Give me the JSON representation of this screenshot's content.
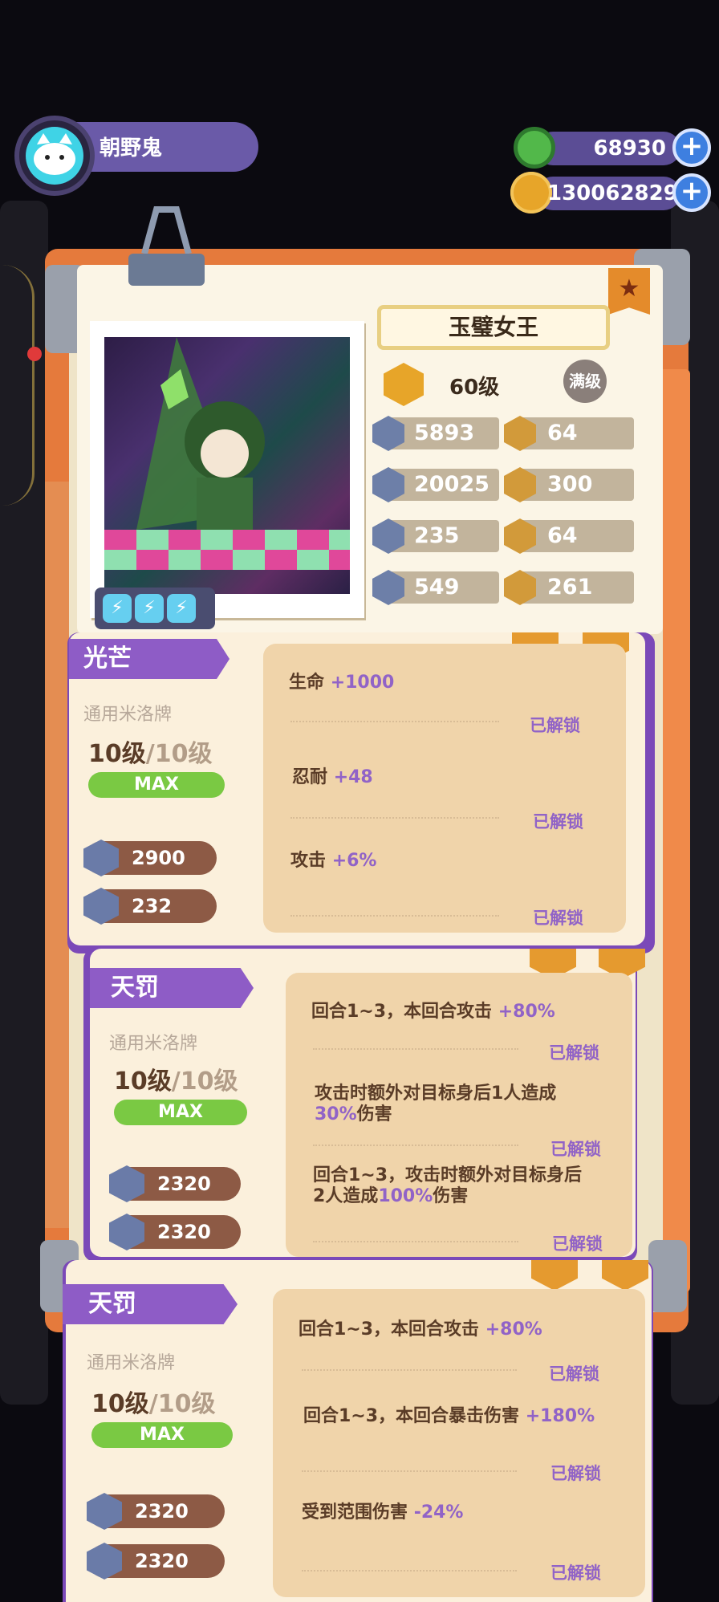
{
  "player": {
    "name": "朝野鬼"
  },
  "resources": [
    {
      "name": "green-currency",
      "value": "68930"
    },
    {
      "name": "gold-currency",
      "value": "130062829"
    }
  ],
  "character": {
    "name": "玉璧女王",
    "level": "60级",
    "max_badge": "满级",
    "energy": [
      "⚡",
      "⚡",
      "⚡"
    ],
    "stats": [
      {
        "icon": "heart-shield-icon",
        "value": "5893",
        "side": "left"
      },
      {
        "icon": "muscle-icon",
        "value": "64",
        "side": "right"
      },
      {
        "icon": "sword-icon",
        "value": "20025",
        "side": "left"
      },
      {
        "icon": "face-icon",
        "value": "300",
        "side": "right"
      },
      {
        "icon": "shield-icon",
        "value": "235",
        "side": "left"
      },
      {
        "icon": "arm-icon",
        "value": "64",
        "side": "right"
      },
      {
        "icon": "anchor-icon",
        "value": "549",
        "side": "left"
      },
      {
        "icon": "brain-icon",
        "value": "261",
        "side": "right"
      }
    ]
  },
  "modules": [
    {
      "title": "光芒",
      "subtitle": "通用米洛牌",
      "level": "10级",
      "level_max": "/10级",
      "max_label": "MAX",
      "stats": [
        {
          "icon": "heart-shield-icon",
          "value": "2900"
        },
        {
          "icon": "anchor-icon",
          "value": "232"
        }
      ],
      "effects": [
        {
          "text": "生命",
          "bonus": "+1000",
          "status": "已解锁"
        },
        {
          "text": "忍耐",
          "bonus": "+48",
          "status": "已解锁"
        },
        {
          "text": "攻击",
          "bonus": "+6%",
          "status": "已解锁"
        }
      ]
    },
    {
      "title": "天罚",
      "subtitle": "通用米洛牌",
      "level": "10级",
      "level_max": "/10级",
      "max_label": "MAX",
      "stats": [
        {
          "icon": "sword-icon",
          "value": "2320"
        },
        {
          "icon": "sword-icon",
          "value": "2320"
        }
      ],
      "effects": [
        {
          "text": "回合1~3，本回合攻击",
          "bonus": "+80%",
          "status": "已解锁"
        },
        {
          "text_a": "攻击时额外对目标身后1人造成",
          "bonus": "30%",
          "text_b": "伤害",
          "status": "已解锁"
        },
        {
          "text_a": "回合1~3，攻击时额外对目标身后2人造成",
          "bonus": "100%",
          "text_b": "伤害",
          "status": "已解锁"
        }
      ]
    },
    {
      "title": "天罚",
      "subtitle": "通用米洛牌",
      "level": "10级",
      "level_max": "/10级",
      "max_label": "MAX",
      "stats": [
        {
          "icon": "sword-icon",
          "value": "2320"
        },
        {
          "icon": "sword-icon",
          "value": "2320"
        }
      ],
      "effects": [
        {
          "text": "回合1~3，本回合攻击",
          "bonus": "+80%",
          "status": "已解锁"
        },
        {
          "text": "回合1~3，本回合暴击伤害",
          "bonus": "+180%",
          "status": "已解锁"
        },
        {
          "text": "受到范围伤害",
          "bonus": "-24%",
          "status": "已解锁"
        }
      ]
    }
  ]
}
